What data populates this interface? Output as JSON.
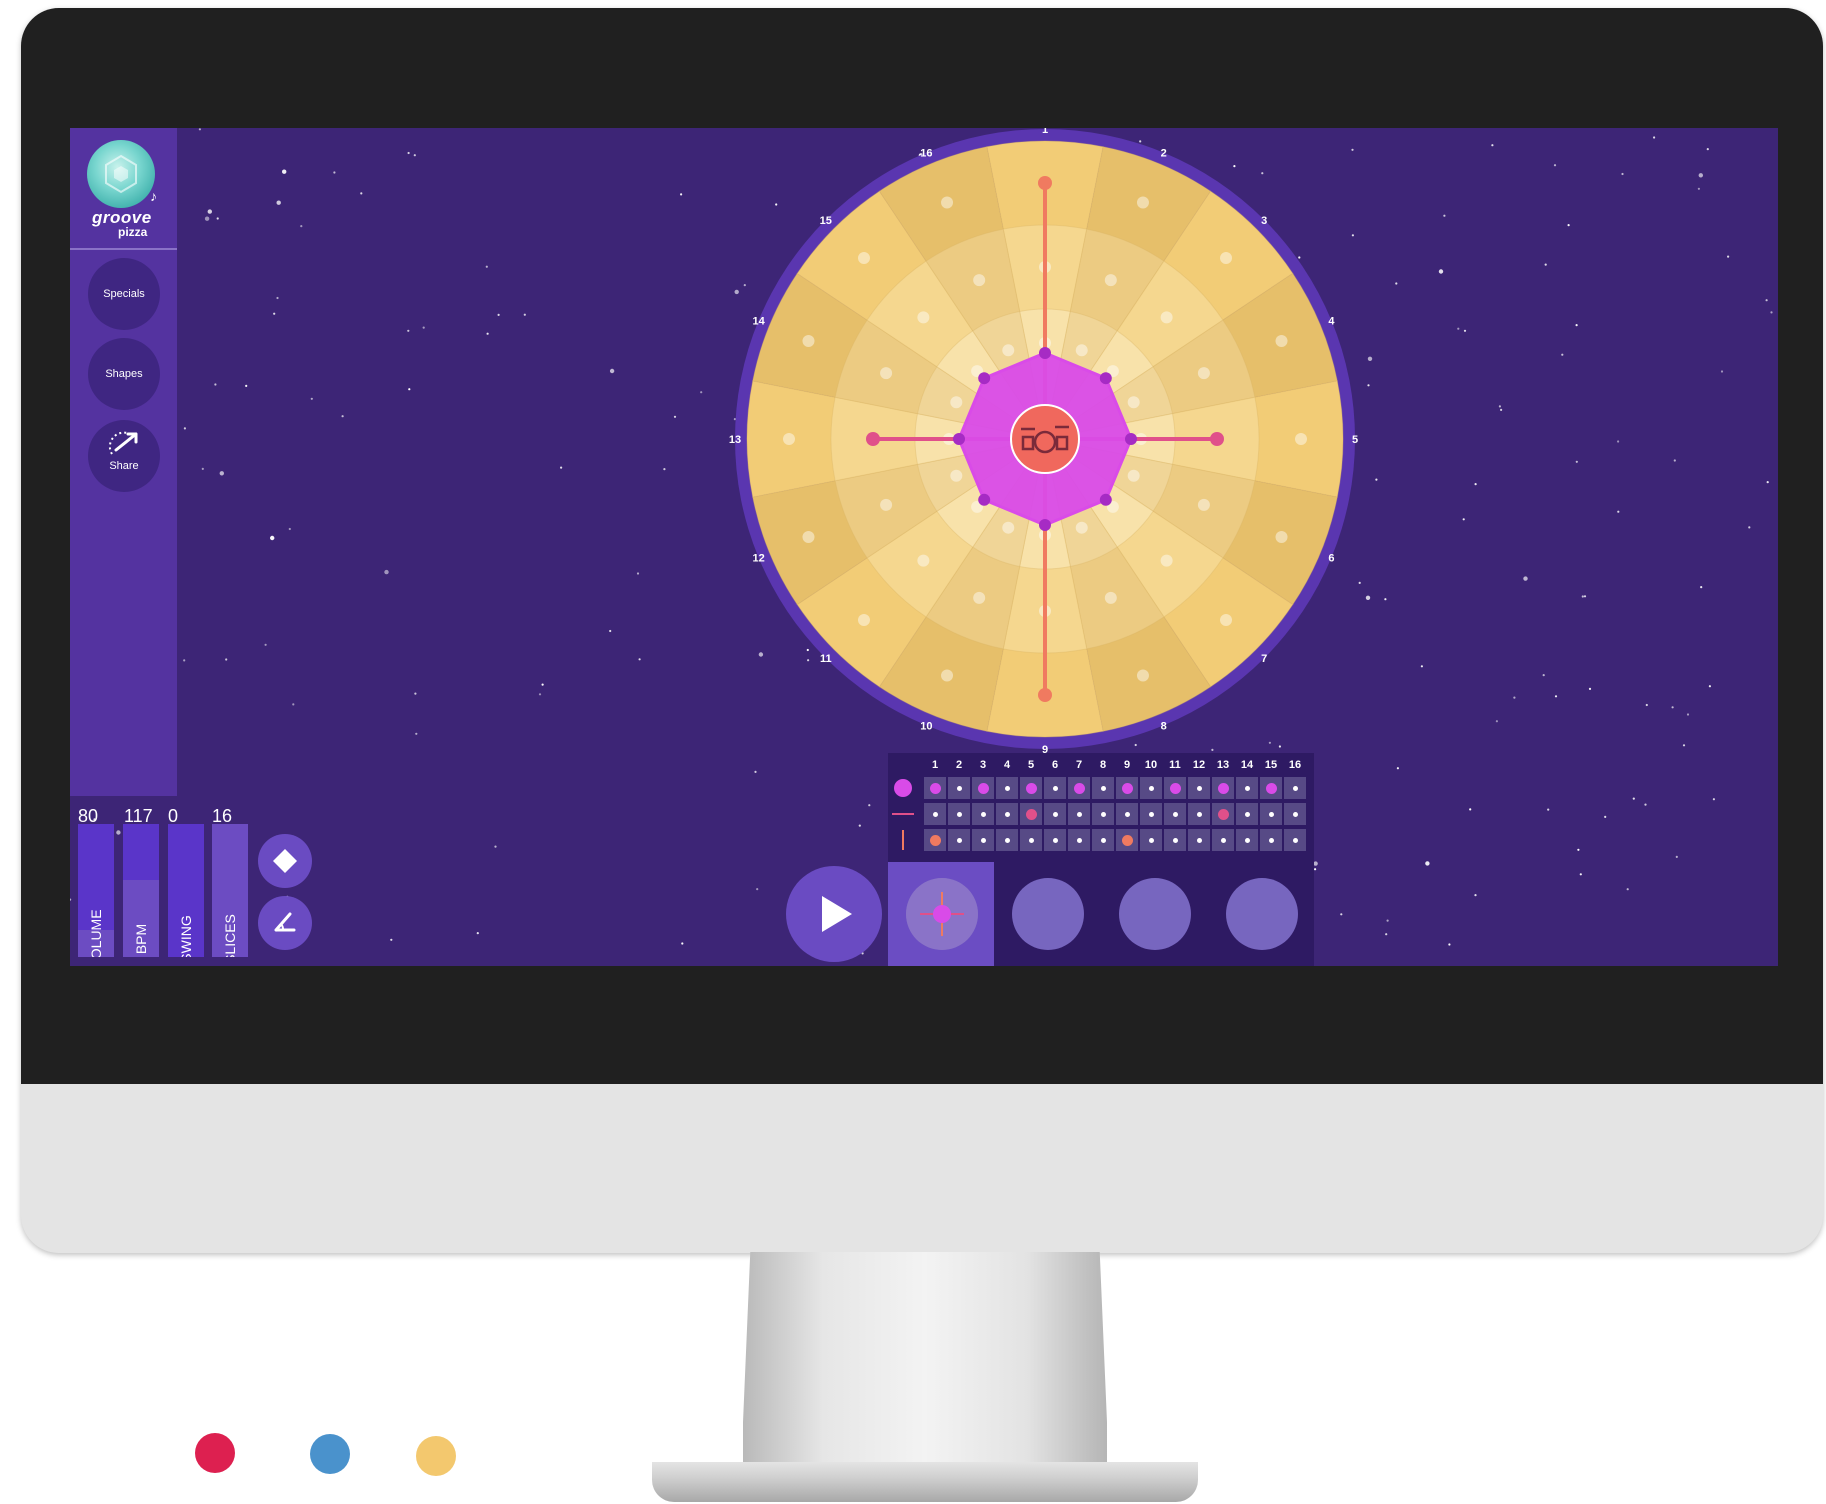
{
  "app": {
    "logo_line1": "groove",
    "logo_line2": "pizza"
  },
  "sidebar": {
    "buttons": [
      {
        "label": "Specials"
      },
      {
        "label": "Shapes"
      },
      {
        "label": "Share"
      }
    ]
  },
  "sliders": [
    {
      "label": "VOLUME",
      "value": "80",
      "level": 0.8
    },
    {
      "label": "BPM",
      "value": "117",
      "level": 0.42
    },
    {
      "label": "SWING",
      "value": "0",
      "level": 1.0
    },
    {
      "label": "SLICES",
      "value": "16",
      "level": 0.0
    }
  ],
  "tools": [
    {
      "icon": "diamond-icon"
    },
    {
      "icon": "angle-icon"
    }
  ],
  "pizza": {
    "slices": [
      "1",
      "2",
      "3",
      "4",
      "5",
      "6",
      "7",
      "8",
      "9",
      "10",
      "11",
      "12",
      "13",
      "14",
      "15",
      "16"
    ],
    "rings": 3,
    "center_icon": "drum-kit-icon",
    "shapes": [
      {
        "name": "octagon",
        "color": "#d94be8",
        "steps": [
          1,
          3,
          5,
          7,
          9,
          11,
          13,
          15
        ]
      },
      {
        "name": "line-horizontal",
        "color": "#e0508a",
        "steps": [
          5,
          13
        ]
      },
      {
        "name": "line-vertical",
        "color": "#f07a60",
        "steps": [
          1,
          9
        ]
      }
    ]
  },
  "sequencer": {
    "steps": [
      "1",
      "2",
      "3",
      "4",
      "5",
      "6",
      "7",
      "8",
      "9",
      "10",
      "11",
      "12",
      "13",
      "14",
      "15",
      "16"
    ],
    "rows": [
      {
        "icon": "octagon-icon",
        "color": "#d94be8",
        "active": [
          1,
          3,
          5,
          7,
          9,
          11,
          13,
          15
        ]
      },
      {
        "icon": "horizontal-line-icon",
        "color": "#e0508a",
        "active": [
          5,
          13
        ]
      },
      {
        "icon": "vertical-line-icon",
        "color": "#f07a60",
        "active": [
          1,
          9
        ]
      }
    ]
  },
  "transport": {
    "play_icon": "play-icon",
    "pattern_slots": 4,
    "active_slot": 1
  },
  "palette": {
    "screen_bg": "#3d2576",
    "pizza_crust": "#e6c06b",
    "swatches": [
      "#dd2050",
      "#4a92cc",
      "#f3c86e"
    ]
  }
}
